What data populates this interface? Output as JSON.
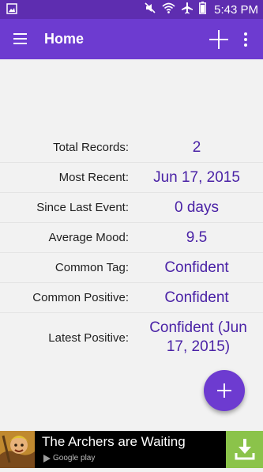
{
  "status_bar": {
    "time": "5:43 PM",
    "icons": [
      "gallery-icon",
      "mute-icon",
      "wifi-icon",
      "airplane-mode-icon",
      "battery-icon"
    ]
  },
  "app_bar": {
    "title": "Home",
    "icons": [
      "menu-icon",
      "add-icon",
      "more-vert-icon"
    ]
  },
  "stats": [
    {
      "label": "Total Records:",
      "value": "2"
    },
    {
      "label": "Most Recent:",
      "value": "Jun 17, 2015"
    },
    {
      "label": "Since Last Event:",
      "value": "0 days"
    },
    {
      "label": "Average Mood:",
      "value": "9.5"
    },
    {
      "label": "Common Tag:",
      "value": "Confident"
    },
    {
      "label": "Common Positive:",
      "value": "Confident"
    },
    {
      "label": "Latest Positive:",
      "value": "Confident (Jun 17, 2015)"
    }
  ],
  "fab": {
    "icon": "add-icon"
  },
  "ad": {
    "title": "The Archers are Waiting",
    "store": "Google play",
    "icon": "download-icon"
  },
  "colors": {
    "status_bar": "#5e2db0",
    "app_bar": "#6d3bd0",
    "value_text": "#4a22a6",
    "download": "#8bc34a"
  }
}
